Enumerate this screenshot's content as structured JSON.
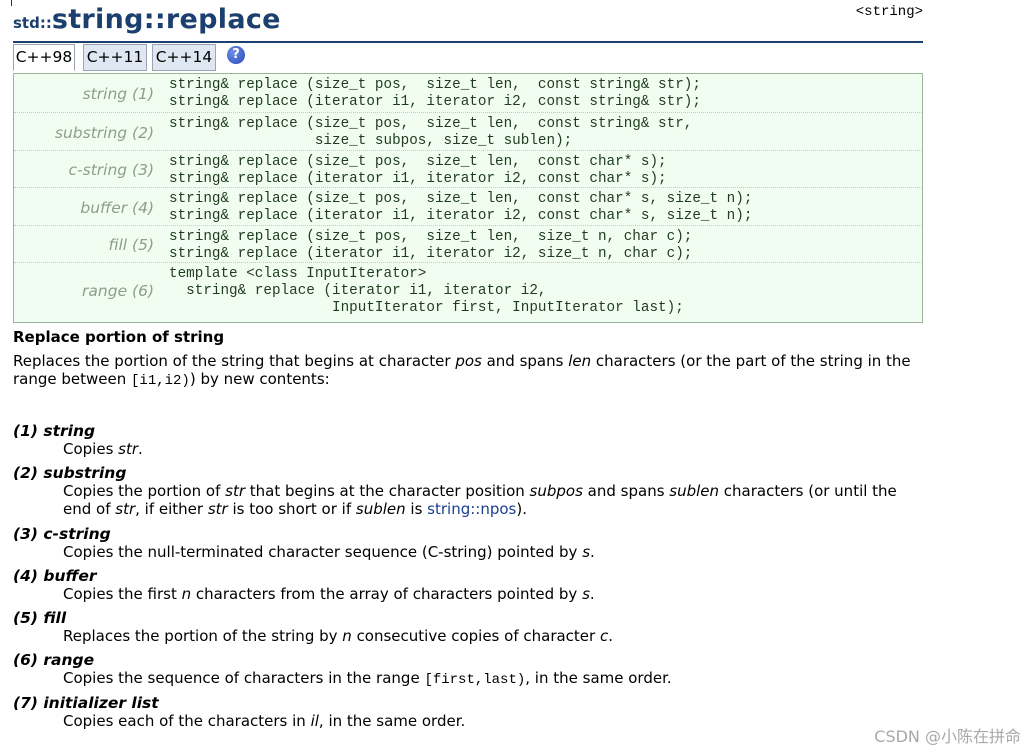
{
  "header": {
    "namespace": "std::",
    "name": "string::replace",
    "tag": "<string>"
  },
  "tabs": [
    {
      "label": "C++98"
    },
    {
      "label": "C++11"
    },
    {
      "label": "C++14"
    }
  ],
  "prototypes": [
    {
      "label": "string (1)",
      "lines": [
        "string& replace (size_t pos,  size_t len,  const string& str);",
        "string& replace (iterator i1, iterator i2, const string& str);"
      ]
    },
    {
      "label": "substring (2)",
      "lines": [
        "string& replace (size_t pos,  size_t len,  const string& str,",
        "                 size_t subpos, size_t sublen);"
      ]
    },
    {
      "label": "c-string (3)",
      "lines": [
        "string& replace (size_t pos,  size_t len,  const char* s);",
        "string& replace (iterator i1, iterator i2, const char* s);"
      ]
    },
    {
      "label": "buffer (4)",
      "lines": [
        "string& replace (size_t pos,  size_t len,  const char* s, size_t n);",
        "string& replace (iterator i1, iterator i2, const char* s, size_t n);"
      ]
    },
    {
      "label": "fill (5)",
      "lines": [
        "string& replace (size_t pos,  size_t len,  size_t n, char c);",
        "string& replace (iterator i1, iterator i2, size_t n, char c);"
      ]
    },
    {
      "label": "range (6)",
      "lines": [
        "template <class InputIterator>",
        "  string& replace (iterator i1, iterator i2,",
        "                   InputIterator first, InputIterator last);"
      ]
    }
  ],
  "section_title": "Replace portion of string",
  "description": {
    "t1": "Replaces the portion of the string that begins at character ",
    "pos": "pos",
    "t2": " and spans ",
    "len": "len",
    "t3": " characters (or the part of the string in the range between ",
    "range": "[i1,i2)",
    "t4": ") by new contents:"
  },
  "items": [
    {
      "head": "(1) string",
      "a": "Copies ",
      "b": "str",
      "c": "."
    },
    {
      "head": "(2) substring",
      "a": "Copies the portion of ",
      "b": "str",
      "c": " that begins at the character position ",
      "d": "subpos",
      "e": " and spans ",
      "f": "sublen",
      "g": " characters (or until the end of ",
      "h": "str",
      "i": ", if either ",
      "j": "str",
      "k": " is too short or if ",
      "l": "sublen",
      "m": " is ",
      "link": "string::npos",
      "n": ")."
    },
    {
      "head": "(3) c-string",
      "a": "Copies the null-terminated character sequence (C-string) pointed by ",
      "b": "s",
      "c": "."
    },
    {
      "head": "(4) buffer",
      "a": "Copies the first ",
      "b": "n",
      "c": " characters from the array of characters pointed by ",
      "d": "s",
      "e": "."
    },
    {
      "head": "(5) fill",
      "a": "Replaces the portion of the string by ",
      "b": "n",
      "c": " consecutive copies of character ",
      "d": "c",
      "e": "."
    },
    {
      "head": "(6) range",
      "a": "Copies the sequence of characters in the range ",
      "b": "[first,last)",
      "c": ", in the same order."
    },
    {
      "head": "(7) initializer list",
      "a": "Copies each of the characters in ",
      "b": "il",
      "c": ", in the same order."
    }
  ],
  "watermark": "CSDN @⁡⁡小陈在拼命⁡⁡"
}
